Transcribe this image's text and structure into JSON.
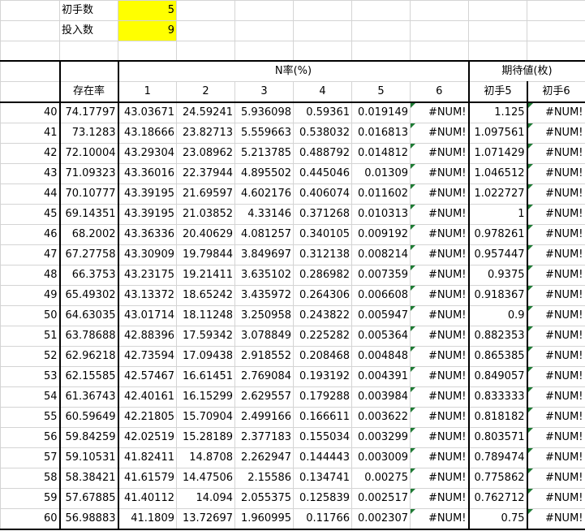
{
  "settings": {
    "first_hand_label": "初手数",
    "first_hand_value": "5",
    "insert_label": "投入数",
    "insert_value": "9"
  },
  "header": {
    "n_rate": "N率(%)",
    "expectation": "期待値(枚)",
    "survival": "存在率",
    "cols": [
      "1",
      "2",
      "3",
      "4",
      "5",
      "6"
    ],
    "exp_cols": [
      "初手5",
      "初手6"
    ]
  },
  "rows": [
    [
      "40",
      "74.17797",
      "43.03671",
      "24.59241",
      "5.936098",
      "0.59361",
      "0.019149",
      "#NUM!",
      "1.125",
      "#NUM!"
    ],
    [
      "41",
      "73.1283",
      "43.18666",
      "23.82713",
      "5.559663",
      "0.538032",
      "0.016813",
      "#NUM!",
      "1.097561",
      "#NUM!"
    ],
    [
      "42",
      "72.10004",
      "43.29304",
      "23.08962",
      "5.213785",
      "0.488792",
      "0.014812",
      "#NUM!",
      "1.071429",
      "#NUM!"
    ],
    [
      "43",
      "71.09323",
      "43.36016",
      "22.37944",
      "4.895502",
      "0.445046",
      "0.01309",
      "#NUM!",
      "1.046512",
      "#NUM!"
    ],
    [
      "44",
      "70.10777",
      "43.39195",
      "21.69597",
      "4.602176",
      "0.406074",
      "0.011602",
      "#NUM!",
      "1.022727",
      "#NUM!"
    ],
    [
      "45",
      "69.14351",
      "43.39195",
      "21.03852",
      "4.33146",
      "0.371268",
      "0.010313",
      "#NUM!",
      "1",
      "#NUM!"
    ],
    [
      "46",
      "68.2002",
      "43.36336",
      "20.40629",
      "4.081257",
      "0.340105",
      "0.009192",
      "#NUM!",
      "0.978261",
      "#NUM!"
    ],
    [
      "47",
      "67.27758",
      "43.30909",
      "19.79844",
      "3.849697",
      "0.312138",
      "0.008214",
      "#NUM!",
      "0.957447",
      "#NUM!"
    ],
    [
      "48",
      "66.3753",
      "43.23175",
      "19.21411",
      "3.635102",
      "0.286982",
      "0.007359",
      "#NUM!",
      "0.9375",
      "#NUM!"
    ],
    [
      "49",
      "65.49302",
      "43.13372",
      "18.65242",
      "3.435972",
      "0.264306",
      "0.006608",
      "#NUM!",
      "0.918367",
      "#NUM!"
    ],
    [
      "50",
      "64.63035",
      "43.01714",
      "18.11248",
      "3.250958",
      "0.243822",
      "0.005947",
      "#NUM!",
      "0.9",
      "#NUM!"
    ],
    [
      "51",
      "63.78688",
      "42.88396",
      "17.59342",
      "3.078849",
      "0.225282",
      "0.005364",
      "#NUM!",
      "0.882353",
      "#NUM!"
    ],
    [
      "52",
      "62.96218",
      "42.73594",
      "17.09438",
      "2.918552",
      "0.208468",
      "0.004848",
      "#NUM!",
      "0.865385",
      "#NUM!"
    ],
    [
      "53",
      "62.15585",
      "42.57467",
      "16.61451",
      "2.769084",
      "0.193192",
      "0.004391",
      "#NUM!",
      "0.849057",
      "#NUM!"
    ],
    [
      "54",
      "61.36743",
      "42.40161",
      "16.15299",
      "2.629557",
      "0.179288",
      "0.003984",
      "#NUM!",
      "0.833333",
      "#NUM!"
    ],
    [
      "55",
      "60.59649",
      "42.21805",
      "15.70904",
      "2.499166",
      "0.166611",
      "0.003622",
      "#NUM!",
      "0.818182",
      "#NUM!"
    ],
    [
      "56",
      "59.84259",
      "42.02519",
      "15.28189",
      "2.377183",
      "0.155034",
      "0.003299",
      "#NUM!",
      "0.803571",
      "#NUM!"
    ],
    [
      "57",
      "59.10531",
      "41.82411",
      "14.8708",
      "2.262947",
      "0.144443",
      "0.003009",
      "#NUM!",
      "0.789474",
      "#NUM!"
    ],
    [
      "58",
      "58.38421",
      "41.61579",
      "14.47506",
      "2.15586",
      "0.134741",
      "0.00275",
      "#NUM!",
      "0.775862",
      "#NUM!"
    ],
    [
      "59",
      "57.67885",
      "41.40112",
      "14.094",
      "2.055375",
      "0.125839",
      "0.002517",
      "#NUM!",
      "0.762712",
      "#NUM!"
    ],
    [
      "60",
      "56.98883",
      "41.1809",
      "13.72697",
      "1.960995",
      "0.11766",
      "0.002307",
      "#NUM!",
      "0.75",
      "#NUM!"
    ]
  ],
  "colors": {
    "input_fill": "#ffff00",
    "error_marker": "#1e7b34",
    "gridline": "#d4d4d4"
  }
}
